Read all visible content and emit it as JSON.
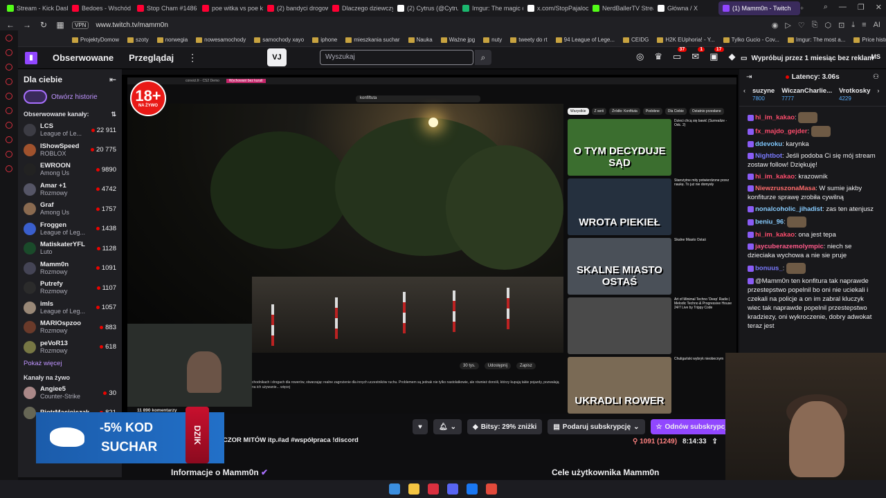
{
  "browser": {
    "tabs": [
      {
        "label": "Stream - Kick Dash",
        "color": "#53fc18"
      },
      {
        "label": "Bedoes - Wschód",
        "color": "#ff0033"
      },
      {
        "label": "Stop Cham #1486",
        "color": "#ff0033"
      },
      {
        "label": "poe witka vs poe k",
        "color": "#ff0033"
      },
      {
        "label": "(2) bandyci drogow",
        "color": "#ff0033"
      },
      {
        "label": "Dlaczego dziewczy",
        "color": "#ff0033"
      },
      {
        "label": "(2) Cytrus (@Cytru",
        "color": "#ffffff"
      },
      {
        "label": "Imgur: The magic o",
        "color": "#1bb76e"
      },
      {
        "label": "x.com/StopPajaloc",
        "color": "#ffffff"
      },
      {
        "label": "NerdBallerTV Strea",
        "color": "#53fc18"
      },
      {
        "label": "Główna / X",
        "color": "#ffffff"
      },
      {
        "label": "(1) Mamm0n - Twitch",
        "color": "#9146ff",
        "active": true
      }
    ],
    "vpn": "VPN",
    "url": "www.twitch.tv/mamm0n",
    "bookmarks": [
      "ProjektyDomow",
      "szoty",
      "norwegia",
      "nowesamochody",
      "samochody xayo",
      "iphone",
      "mieszkania suchar",
      "Nauka",
      "Ważne jpg",
      "nuty",
      "tweety do rt",
      "94 League of Lege...",
      "CEIDG",
      "H2K EUphoria! - Y...",
      "Tylko Gucio - Cov...",
      "Imgur: The most a...",
      "Price history, price..."
    ]
  },
  "topnav": {
    "following": "Obserwowane",
    "browse": "Przeglądaj",
    "vj": "VJ",
    "search_placeholder": "Wyszukaj",
    "badge1": "37",
    "badge2": "1",
    "badge3": "17",
    "promo": "Wypróbuj przez 1 miesiąc bez reklam",
    "user": "MS"
  },
  "sidebar": {
    "title": "Dla ciebie",
    "stories": "Otwórz historie",
    "followed_header": "Obserwowane kanały:",
    "channels": [
      {
        "name": "LCS",
        "game": "League of Le...",
        "viewers": "22 911",
        "av": "#3c3c44"
      },
      {
        "name": "IShowSpeed",
        "game": "ROBLOX",
        "viewers": "20 775",
        "av": "#a0522d"
      },
      {
        "name": "EWROON",
        "game": "Among Us",
        "viewers": "9890",
        "av": "#222"
      },
      {
        "name": "Amar +1",
        "game": "Rozmowy",
        "viewers": "4742",
        "av": "#556"
      },
      {
        "name": "Graf",
        "game": "Among Us",
        "viewers": "1757",
        "av": "#8a6a50"
      },
      {
        "name": "Froggen",
        "game": "League of Leg...",
        "viewers": "1438",
        "av": "#3a5fcd"
      },
      {
        "name": "MatiskaterYFL",
        "game": "Luto",
        "viewers": "1128",
        "av": "#1a4a2a"
      },
      {
        "name": "Mamm0n",
        "game": "Rozmowy",
        "viewers": "1091",
        "av": "#445"
      },
      {
        "name": "Putrefy",
        "game": "Rozmowy",
        "viewers": "1107",
        "av": "#2b2b2b"
      },
      {
        "name": "imls",
        "game": "League of Leg...",
        "viewers": "1057",
        "av": "#998877"
      },
      {
        "name": "MARIOspzoo",
        "game": "Rozmowy",
        "viewers": "883",
        "av": "#6a3a2a"
      },
      {
        "name": "peVoR13",
        "game": "Rozmowy",
        "viewers": "618",
        "av": "#774"
      }
    ],
    "show_more": "Pokaż więcej",
    "live_header": "Kanały na żywo",
    "live": [
      {
        "name": "Angiee5",
        "game": "Counter-Strike",
        "viewers": "30",
        "av": "#a88"
      },
      {
        "name": "PiotrMaciejczak",
        "game": "",
        "viewers": "821",
        "av": "#665"
      }
    ]
  },
  "player": {
    "age_badge": "18+",
    "age_sub": "NA ŻYWO",
    "inner_tabs": [
      "convict.fr - CS2 Demo",
      "Wychowani bez kurati"
    ],
    "inner_search": "konfiftuta",
    "chips": [
      "Wszystkie",
      "Z serii",
      "Źródło: Konfituta",
      "Podobne",
      "Dla Ciebie",
      "Ostatnio przesłane"
    ],
    "recs": [
      {
        "thumb": "O TYM DECYDUJE SĄD",
        "title": "Dzieci chcą się bawić (Surrealize - Odc. 2)",
        "bg": "#3b6e2f"
      },
      {
        "thumb": "WROTA PIEKIEŁ",
        "title": "Starożytne mity potwierdzone przez naukę. To już nie domysły",
        "bg": "#25303e"
      },
      {
        "thumb": "SKALNE MIASTO OSTAŚ",
        "title": "Skalne Miasto Ostaś",
        "bg": "#4a5058"
      },
      {
        "thumb": "",
        "title": "Art of Minimal Techno 'Deep' Radio | Melodic Techno & Progressive House 24/7 Live by Trippy Code",
        "bg": "#4a4a4a"
      },
      {
        "thumb": "UKRADLI ROWER",
        "title": "Chuligański wybryk nieobecnym",
        "bg": "#7a6a55"
      }
    ],
    "yt_actions": [
      "30 tys.",
      "Udostępnij",
      "Zapisz"
    ],
    "desc": "chodnikach i drogach dla rowerów, stwarzając realne zagrożenie dla innych uczestników ruchu. Problemem są jednak nie tylko nastolatkowie, ale również dorośli, którzy kupują takie pojazdy, pozwalają na ich używanie... więcej",
    "comments": "11 890 komentarzy"
  },
  "ad": {
    "pct": "-5% KOD",
    "code": "SUCHAR",
    "can": "DZIK"
  },
  "stream": {
    "title": "CZOR MITÓW itp.#ad #współpraca !discord",
    "bits": "Bitsy: 29% zniżki",
    "gift": "Podaruj subskrypcję",
    "resub": "Odnów subskrypcję",
    "viewers": "1091 (1249)",
    "uptime": "8:14:33",
    "info": "Informacje o Mamm0n",
    "goals": "Cele użytkownika Mamm0n"
  },
  "chat": {
    "latency": "Latency: 3.06s",
    "pinned": [
      {
        "name": "suzyne",
        "pts": "7800"
      },
      {
        "name": "WiczanCharlie...",
        "pts": "7777"
      },
      {
        "name": "Vrotkosky",
        "pts": "4229"
      }
    ],
    "messages": [
      {
        "user": "hi_im_kakao",
        "color": "#ff4d6d",
        "text": ""
      },
      {
        "user": "fx_majdo_gejder",
        "color": "#ff4d6d",
        "text": ""
      },
      {
        "user": "ddevoku",
        "color": "#7fc8ff",
        "text": "karynka"
      },
      {
        "user": "Nightbot",
        "color": "#7a7aff",
        "text": "Jeśli podoba Ci się mój stream zostaw follow! Dziękuję!"
      },
      {
        "user": "hi_im_kakao",
        "color": "#ff4d6d",
        "text": "krazownik"
      },
      {
        "user": "NiewzruszonaMasa",
        "color": "#ff6b6b",
        "text": "W sumie jakby konfiturze sprawę zrobiła cywilną"
      },
      {
        "user": "nonalcoholic_jihadist",
        "color": "#8cf",
        "text": "zas ten atenjusz"
      },
      {
        "user": "beniu_96",
        "color": "#8cf",
        "text": ""
      },
      {
        "user": "hi_im_kakao",
        "color": "#ff4d6d",
        "text": "ona jest tepa"
      },
      {
        "user": "jaycuberazemolympic",
        "color": "#ff5a8a",
        "text": "niech se dzieciaka wychowa a nie sie pruje"
      },
      {
        "user": "bonuus_",
        "color": "#7a7aff",
        "text": ""
      },
      {
        "user": "",
        "color": "#4a6aff",
        "text": "@Mamm0n ten konfitura tak naprawde przestepstwo popelnil bo oni nie uciekali i czekali na policje a on im zabral kluczyk wiec tak naprawde popelnil przestepstwo kradziezy, oni wykroczenie, dobry adwokat teraz jest"
      }
    ]
  },
  "taskbar": {
    "icons": [
      "windows-icon",
      "folder-icon",
      "opera-icon",
      "discord-icon",
      "messenger-icon",
      "chrome-icon"
    ]
  }
}
